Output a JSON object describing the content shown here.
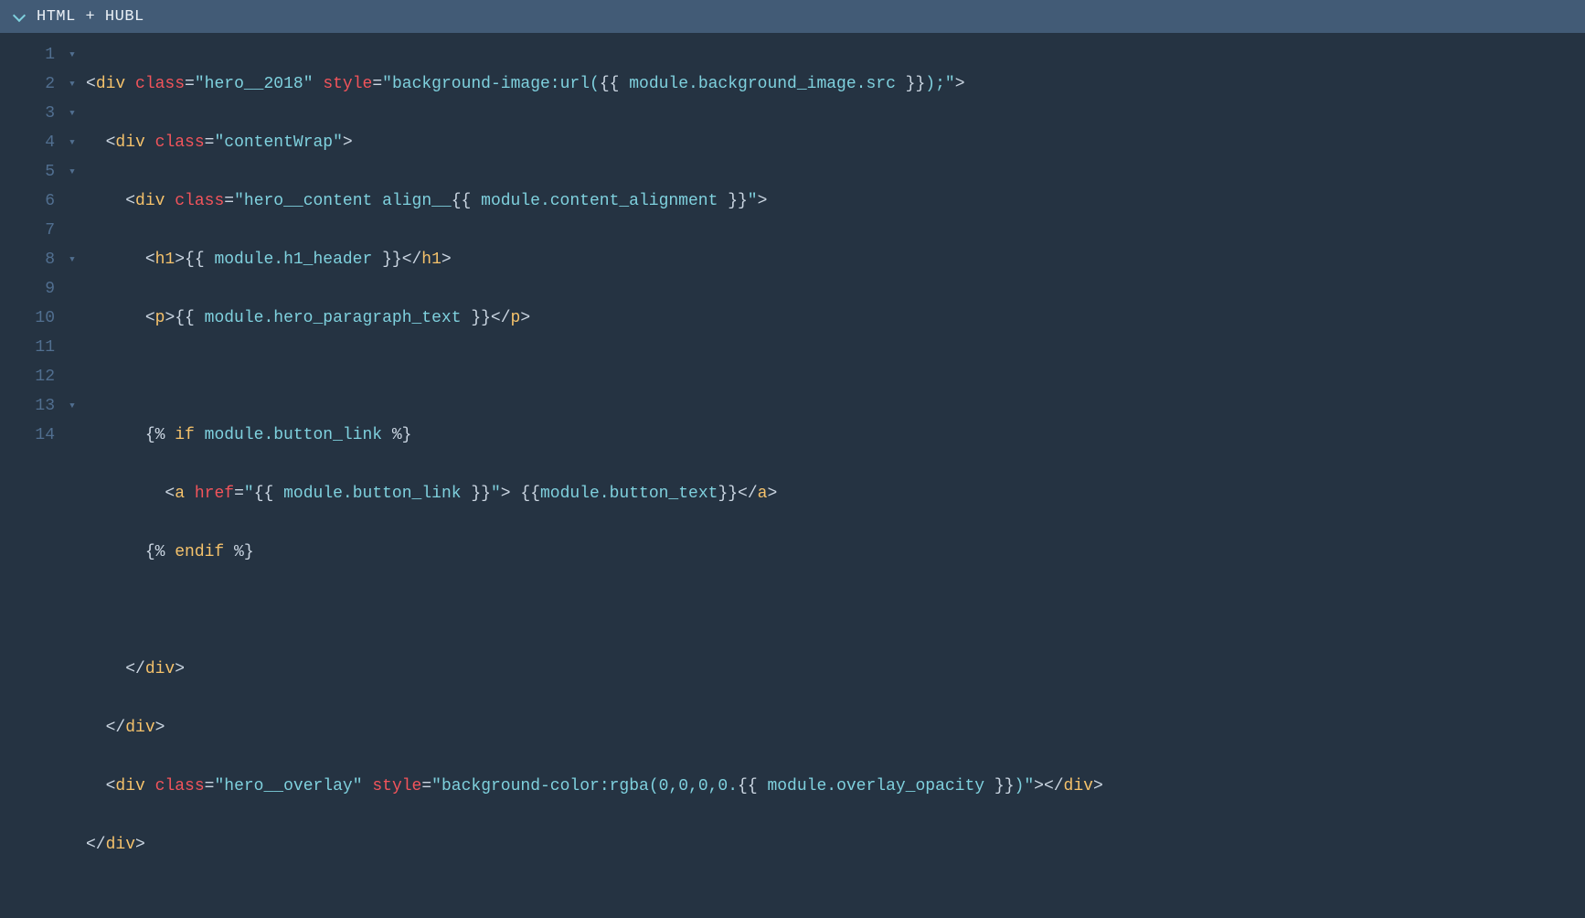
{
  "header": {
    "title": "HTML + HUBL"
  },
  "gutter": {
    "numbers": [
      "1",
      "2",
      "3",
      "4",
      "5",
      "6",
      "7",
      "8",
      "9",
      "10",
      "11",
      "12",
      "13",
      "14"
    ]
  },
  "fold": {
    "marks": [
      "▼",
      "▼",
      "▼",
      "▼",
      "▼",
      "",
      "",
      "▼",
      "",
      "",
      "",
      "",
      "▼",
      ""
    ]
  },
  "code": {
    "l1": {
      "open": "<",
      "tag": "div",
      "a1": "class",
      "eq": "=",
      "q": "\"",
      "v1": "hero__2018",
      "a2": "style",
      "v2a": "background-image:url(",
      "dlo": "{{ ",
      "var": "module.background_image.src",
      "dlc": " }}",
      "v2b": ");",
      "close": ">"
    },
    "l2": {
      "indent": "  ",
      "open": "<",
      "tag": "div",
      "a1": "class",
      "eq": "=",
      "q": "\"",
      "v1": "contentWrap",
      "close": ">"
    },
    "l3": {
      "indent": "    ",
      "open": "<",
      "tag": "div",
      "a1": "class",
      "eq": "=",
      "q": "\"",
      "v1a": "hero__content align__",
      "dlo": "{{ ",
      "var": "module.content_alignment",
      "dlc": " }}",
      "close": ">"
    },
    "l4": {
      "indent": "      ",
      "open": "<",
      "tag": "h1",
      "close": ">",
      "dlo": "{{ ",
      "var": "module.h1_header",
      "dlc": " }}",
      "copen": "</",
      "ctag": "h1",
      "cclose": ">"
    },
    "l5": {
      "indent": "      ",
      "open": "<",
      "tag": "p",
      "close": ">",
      "dlo": "{{ ",
      "var": "module.hero_paragraph_text",
      "dlc": " }}",
      "copen": "</",
      "ctag": "p",
      "cclose": ">"
    },
    "l6": {
      "text": ""
    },
    "l7": {
      "indent": "      ",
      "dlo": "{% ",
      "kw": "if",
      "sp": " ",
      "var": "module.button_link",
      "dlc": " %}"
    },
    "l8": {
      "indent": "        ",
      "open": "<",
      "tag": "a",
      "a1": "href",
      "eq": "=",
      "q": "\"",
      "dlo": "{{ ",
      "var": "module.button_link",
      "dlc": " }}",
      "close": ">",
      "sp": " ",
      "dlo2": "{{",
      "var2": "module.button_text",
      "dlc2": "}}",
      "copen": "</",
      "ctag": "a",
      "cclose": ">"
    },
    "l9": {
      "indent": "      ",
      "dlo": "{% ",
      "kw": "endif",
      "dlc": " %}"
    },
    "l10": {
      "text": ""
    },
    "l11": {
      "indent": "    ",
      "copen": "</",
      "ctag": "div",
      "cclose": ">"
    },
    "l12": {
      "indent": "  ",
      "copen": "</",
      "ctag": "div",
      "cclose": ">"
    },
    "l13": {
      "indent": "  ",
      "open": "<",
      "tag": "div",
      "a1": "class",
      "eq": "=",
      "q": "\"",
      "v1": "hero__overlay",
      "a2": "style",
      "v2a": "background-color:rgba(0,0,0,0.",
      "dlo": "{{ ",
      "var": "module.overlay_opacity",
      "dlc": " }}",
      "v2b": ")",
      "close": ">",
      "copen": "</",
      "ctag": "div",
      "cclose": ">"
    },
    "l14": {
      "copen": "</",
      "ctag": "div",
      "cclose": ">"
    }
  }
}
